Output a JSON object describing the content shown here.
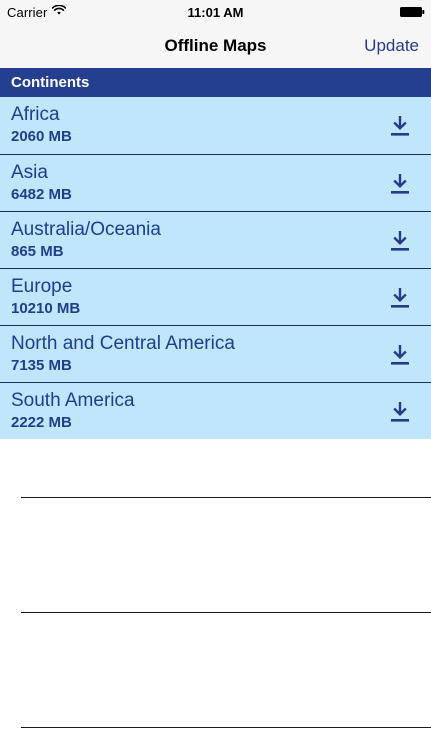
{
  "status_bar": {
    "carrier": "Carrier",
    "time": "11:01 AM",
    "wifi_icon": "wifi-icon",
    "battery_icon": "battery-icon"
  },
  "nav": {
    "title": "Offline Maps",
    "action": "Update"
  },
  "section": {
    "title": "Continents"
  },
  "items": [
    {
      "name": "Africa",
      "size": "2060 MB",
      "icon": "download-icon"
    },
    {
      "name": "Asia",
      "size": "6482 MB",
      "icon": "download-icon"
    },
    {
      "name": "Australia/Oceania",
      "size": "865 MB",
      "icon": "download-icon"
    },
    {
      "name": "Europe",
      "size": "10210 MB",
      "icon": "download-icon"
    },
    {
      "name": "North and Central America",
      "size": "7135 MB",
      "icon": "download-icon"
    },
    {
      "name": "South America",
      "size": "2222 MB",
      "icon": "download-icon"
    }
  ],
  "colors": {
    "nav_background": "#f6f6f7",
    "header_background": "#243f8f",
    "row_background": "#bfe6fb",
    "accent": "#263b8a",
    "text": "#1c3f91"
  }
}
